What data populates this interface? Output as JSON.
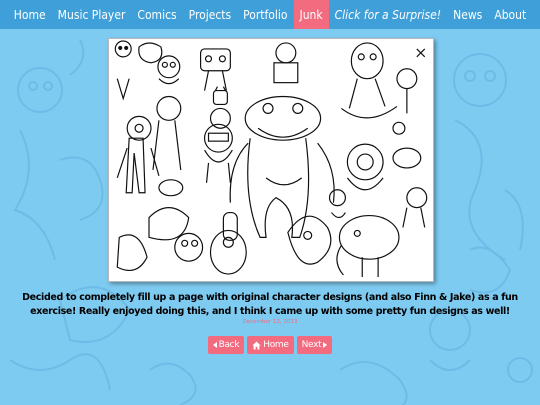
{
  "nav": {
    "items": [
      {
        "label": "Home"
      },
      {
        "label": "Music Player"
      },
      {
        "label": "Comics"
      },
      {
        "label": "Projects"
      },
      {
        "label": "Portfolio"
      },
      {
        "label": "Junk"
      },
      {
        "label": "Click for a Surprise!"
      },
      {
        "label": "News"
      },
      {
        "label": "About"
      }
    ],
    "active_index": 5
  },
  "post": {
    "caption": "Decided to completely fill up a page with original character designs (and also Finn & Jake) as a fun exercise! Really enjoyed doing this, and I think I came up with some pretty fun designs as well!",
    "date": "December 12, 2013"
  },
  "pager": {
    "back_label": "Back",
    "home_label": "Home",
    "next_label": "Next"
  },
  "colors": {
    "background": "#7ecbf2",
    "navbar": "#3f9fd8",
    "accent": "#f36b7f"
  },
  "icons": {
    "back": "triangle-left-icon",
    "home": "house-icon",
    "next": "triangle-right-icon"
  }
}
